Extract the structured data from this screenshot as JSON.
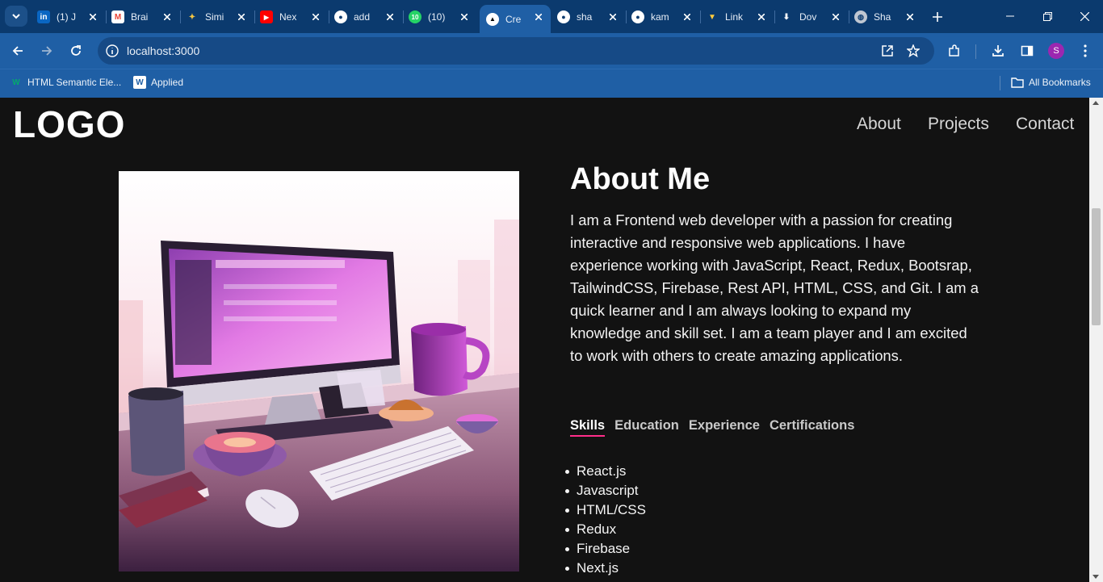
{
  "browser": {
    "tabs": [
      {
        "label": "(1) J",
        "icon": "linkedin-icon",
        "color": "#0a66c2",
        "glyph": "in"
      },
      {
        "label": "Brai",
        "icon": "gmail-icon",
        "color": "#ea4335",
        "glyph": "M"
      },
      {
        "label": "Simi",
        "icon": "similar-icon",
        "color": "#f4a73b",
        "glyph": "✦"
      },
      {
        "label": "Nex",
        "icon": "youtube-icon",
        "color": "#ff0000",
        "glyph": "▶"
      },
      {
        "label": "add",
        "icon": "github-icon",
        "color": "#ffffff",
        "glyph": "●"
      },
      {
        "label": "(10)",
        "icon": "whatsapp-icon",
        "color": "#25d366",
        "glyph": "10"
      },
      {
        "label": "Cre",
        "icon": "nextjs-icon",
        "color": "#000000",
        "glyph": "▲"
      },
      {
        "label": "sha",
        "icon": "github-icon",
        "color": "#ffffff",
        "glyph": "●"
      },
      {
        "label": "kam",
        "icon": "github-icon",
        "color": "#ffffff",
        "glyph": "●"
      },
      {
        "label": "Link",
        "icon": "vite-icon",
        "color": "#a66cff",
        "glyph": "▼"
      },
      {
        "label": "Dov",
        "icon": "download-icon",
        "color": "#ffffff",
        "glyph": "⬇"
      },
      {
        "label": "Sha",
        "icon": "globe-icon",
        "color": "#bfc7d2",
        "glyph": "◍"
      }
    ],
    "url": "localhost:3000",
    "profile_initial": "S",
    "bookmarks": [
      {
        "label": "HTML Semantic Ele...",
        "icon": "w3-icon"
      },
      {
        "label": "Applied",
        "icon": "wordpress-icon"
      }
    ],
    "all_bookmarks_label": "All Bookmarks"
  },
  "site": {
    "logo": "LOGO",
    "nav": [
      "About",
      "Projects",
      "Contact"
    ],
    "about_title": "About Me",
    "about_text": "I am a Frontend web developer with a passion for creating interactive and responsive web applications. I have experience working with JavaScript, React, Redux, Bootsrap, TailwindCSS, Firebase, Rest API, HTML, CSS, and Git. I am a quick learner and I am always looking to expand my knowledge and skill set. I am a team player and I am excited to work with others to create amazing applications.",
    "tabs": [
      "Skills",
      "Education",
      "Experience",
      "Certifications"
    ],
    "active_tab": "Skills",
    "skills": [
      "React.js",
      "Javascript",
      "HTML/CSS",
      "Redux",
      "Firebase",
      "Next.js"
    ],
    "accent_color": "#ff2d8a"
  }
}
